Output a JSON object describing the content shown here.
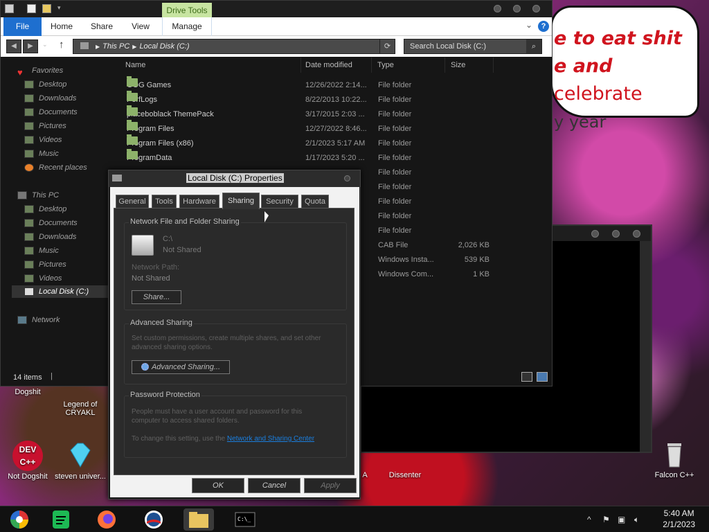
{
  "desktop": {
    "speech_lines": [
      "e to eat shit",
      "e and celebrate",
      "y year"
    ],
    "speech_line2_prefix": "e and ",
    "speech_line2_suffix": "celebrate",
    "icons": [
      {
        "label": "Dogshit"
      },
      {
        "label": "Legend of CRYAKL"
      },
      {
        "label": "Not Dogshit"
      },
      {
        "label": "steven univer..."
      },
      {
        "label": "A"
      },
      {
        "label": "Dissenter"
      },
      {
        "label": "Falcon C++"
      },
      {
        "label": "DEV C++"
      }
    ]
  },
  "explorer": {
    "contextual_tab": "Drive Tools",
    "ribbon_tabs": [
      "File",
      "Home",
      "Share",
      "View",
      "Manage"
    ],
    "breadcrumb": [
      "This PC",
      "Local Disk (C:)"
    ],
    "search_placeholder": "Search Local Disk (C:)",
    "nav": {
      "favorites_header": "Favorites",
      "favorites": [
        "Desktop",
        "Downloads",
        "Documents",
        "Pictures",
        "Videos",
        "Music",
        "Recent places"
      ],
      "thispc_header": "This PC",
      "thispc": [
        "Desktop",
        "Documents",
        "Downloads",
        "Music",
        "Pictures",
        "Videos",
        "Local Disk (C:)"
      ],
      "network": "Network"
    },
    "columns": [
      "Name",
      "Date modified",
      "Type",
      "Size"
    ],
    "files": [
      {
        "name": "GOG Games",
        "date": "12/26/2022 2:14...",
        "type": "File folder",
        "size": ""
      },
      {
        "name": "PerfLogs",
        "date": "8/22/2013 10:22...",
        "type": "File folder",
        "size": ""
      },
      {
        "name": "placeboblack ThemePack",
        "date": "3/17/2015 2:03 ...",
        "type": "File folder",
        "size": ""
      },
      {
        "name": "Program Files",
        "date": "12/27/2022 8:46...",
        "type": "File folder",
        "size": ""
      },
      {
        "name": "Program Files (x86)",
        "date": "2/1/2023 5:17 AM",
        "type": "File folder",
        "size": ""
      },
      {
        "name": "ProgramData",
        "date": "1/17/2023 5:20 ...",
        "type": "File folder",
        "size": ""
      },
      {
        "name": "",
        "date": "",
        "type": "File folder",
        "size": ""
      },
      {
        "name": "",
        "date": "",
        "type": "File folder",
        "size": ""
      },
      {
        "name": "",
        "date": "",
        "type": "File folder",
        "size": ""
      },
      {
        "name": "",
        "date": "",
        "type": "File folder",
        "size": ""
      },
      {
        "name": "",
        "date": "",
        "type": "File folder",
        "size": ""
      },
      {
        "name": "",
        "date": "",
        "type": "CAB File",
        "size": "2,026 KB"
      },
      {
        "name": "",
        "date": "",
        "type": "Windows Insta...",
        "size": "539 KB"
      },
      {
        "name": "",
        "date": "",
        "type": "Windows Com...",
        "size": "1 KB"
      }
    ],
    "status": "14 items"
  },
  "props": {
    "title": "Local Disk (C:) Properties",
    "tabs": [
      "General",
      "Tools",
      "Hardware",
      "Sharing",
      "Security",
      "Quota"
    ],
    "active_tab": "Sharing",
    "nfs_group": "Network File and Folder Sharing",
    "drive_name": "C:\\",
    "drive_state": "Not Shared",
    "network_path_label": "Network Path:",
    "network_path_value": "Not Shared",
    "share_btn": "Share...",
    "adv_group": "Advanced Sharing",
    "adv_desc": "Set custom permissions, create multiple shares, and set other advanced sharing options.",
    "adv_btn": "Advanced Sharing...",
    "pw_group": "Password Protection",
    "pw_desc": "People must have a user account and password for this computer to access shared folders.",
    "pw_change": "To change this setting, use the",
    "pw_link": "Network and Sharing Center",
    "ok": "OK",
    "cancel": "Cancel",
    "apply": "Apply"
  },
  "taskbar": {
    "time": "5:40 AM",
    "date": "2/1/2023"
  }
}
